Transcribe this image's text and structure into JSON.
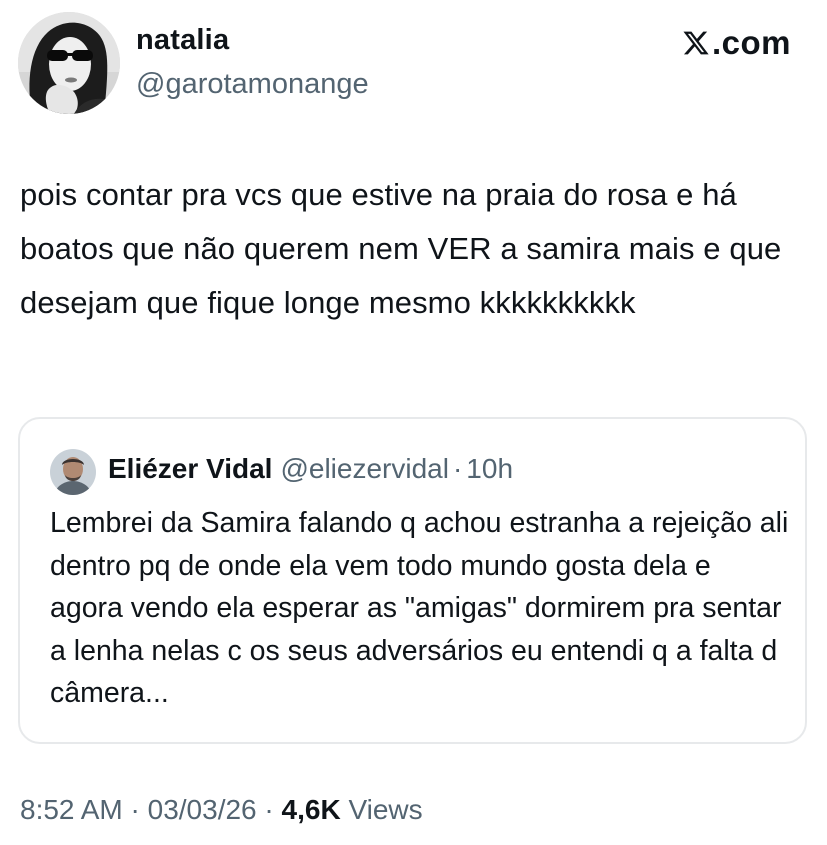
{
  "author": {
    "name": "natalia",
    "handle": "@garotamonange"
  },
  "brand": {
    "label": ".com",
    "icon": "x-logo-icon"
  },
  "tweet": {
    "text": "pois contar pra vcs que estive na praia do rosa e há boatos que não querem nem VER a samira mais e que desejam que fique longe mesmo kkkkkkkkkk"
  },
  "quoted_tweet": {
    "name": "Eliézer Vidal",
    "handle": "@eliezervidal",
    "separator": "·",
    "time": "10h",
    "text": "Lembrei da Samira falando q achou estranha a rejeição ali dentro pq de onde ela vem todo mundo gosta dela e agora vendo ela esperar as \"amigas\" dormirem pra sentar a lenha nelas c os seus adversários eu entendi q a falta d câmera..."
  },
  "footer": {
    "time": "8:52 AM",
    "sep1": "·",
    "date": "03/03/26",
    "sep2": "·",
    "views_count": "4,6K",
    "views_label": "Views"
  },
  "colors": {
    "text_primary": "#0f1419",
    "text_secondary": "#536471",
    "border": "#e7e9eb",
    "background": "#ffffff"
  }
}
